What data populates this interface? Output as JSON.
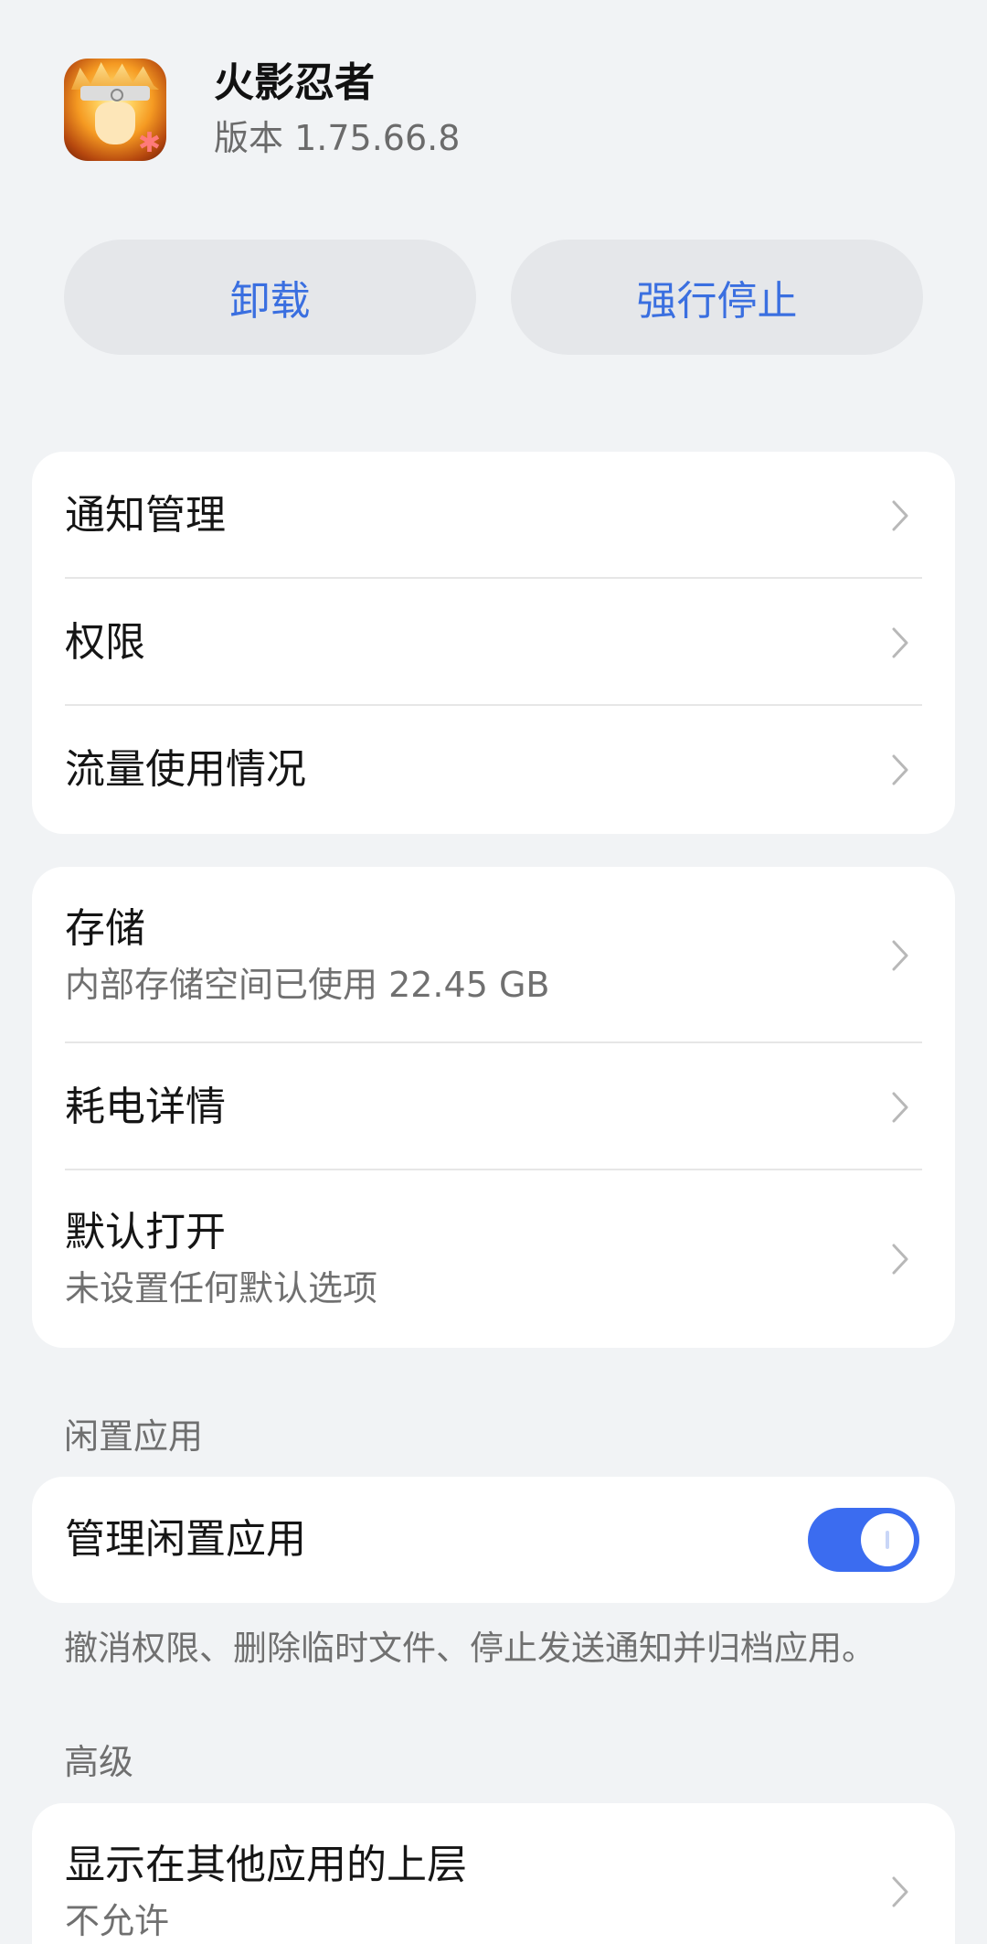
{
  "app": {
    "name": "火影忍者",
    "version": "版本 1.75.66.8"
  },
  "actions": {
    "uninstall_label": "卸载",
    "force_stop_label": "强行停止"
  },
  "group1": {
    "items": [
      {
        "title": "通知管理"
      },
      {
        "title": "权限"
      },
      {
        "title": "流量使用情况"
      }
    ]
  },
  "group2": {
    "items": [
      {
        "title": "存储",
        "subtitle": "内部存储空间已使用 22.45 GB"
      },
      {
        "title": "耗电详情"
      },
      {
        "title": "默认打开",
        "subtitle": "未设置任何默认选项"
      }
    ]
  },
  "idle": {
    "section_label": "闲置应用",
    "toggle_title": "管理闲置应用",
    "toggle_on": true,
    "hint": "撤消权限、删除临时文件、停止发送通知并归档应用。"
  },
  "advanced": {
    "section_label": "高级",
    "items": [
      {
        "title": "显示在其他应用的上层",
        "subtitle": "不允许"
      }
    ]
  },
  "colors": {
    "accent": "#3b6cf0",
    "button_text": "#3a6fe0",
    "background": "#f1f3f5"
  }
}
